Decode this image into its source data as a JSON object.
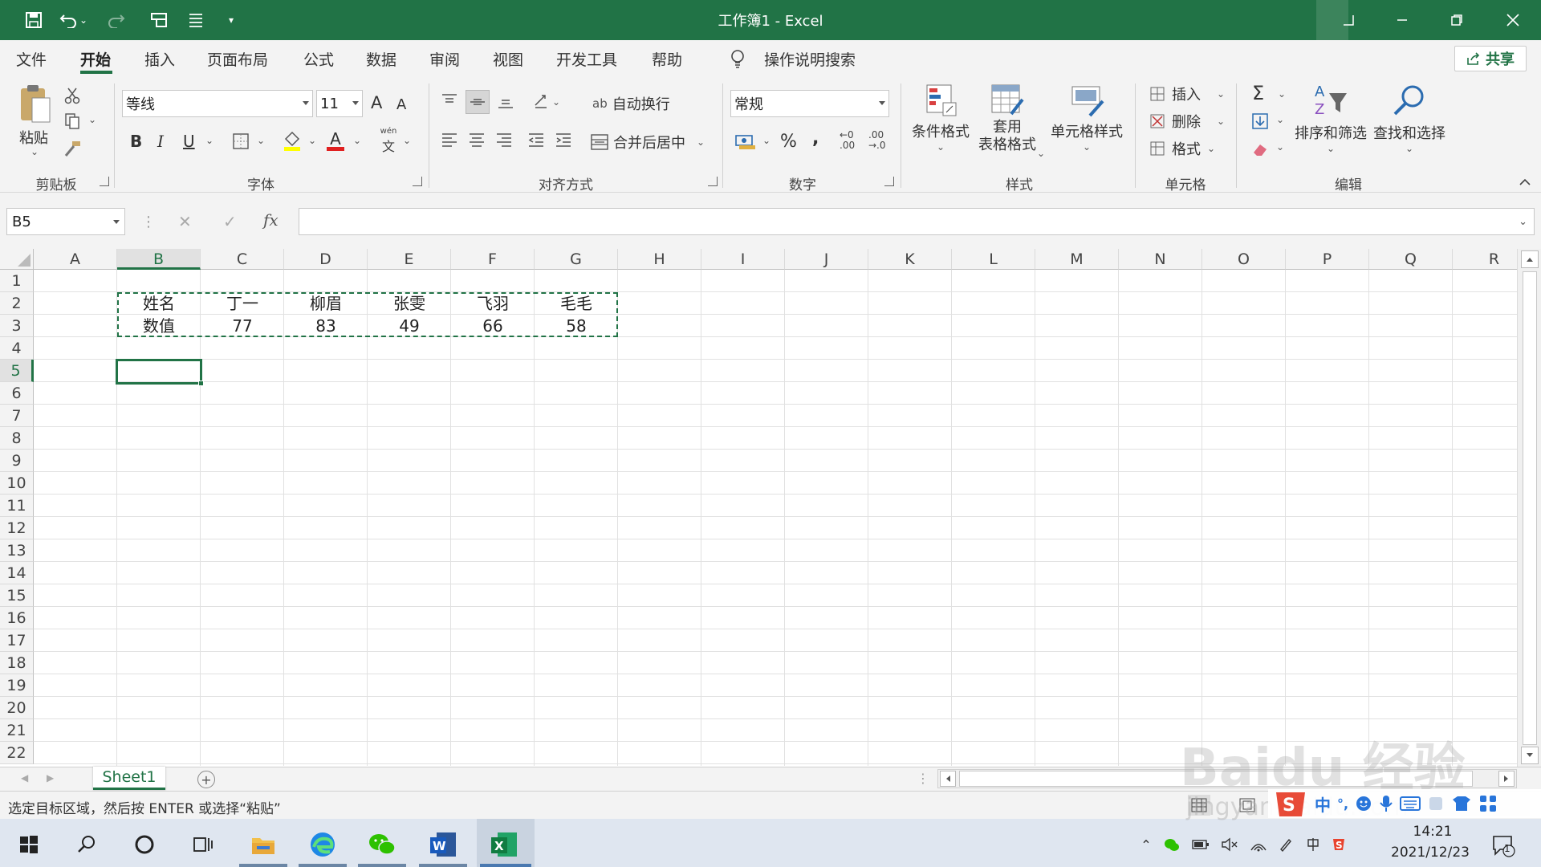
{
  "window": {
    "title": "工作簿1  -  Excel"
  },
  "menu_tabs": [
    "文件",
    "开始",
    "插入",
    "页面布局",
    "公式",
    "数据",
    "审阅",
    "视图",
    "开发工具",
    "帮助"
  ],
  "active_tab": "开始",
  "tell_me": "操作说明搜索",
  "share_label": "共享",
  "ribbon": {
    "clipboard": {
      "paste_label": "粘贴",
      "group_label": "剪贴板"
    },
    "font": {
      "font_name": "等线",
      "font_size": "11",
      "grow_label": "A",
      "shrink_label": "A",
      "bold": "B",
      "italic": "I",
      "underline": "U",
      "font_color_label": "A",
      "phonetic_top": "wén",
      "phonetic_bottom": "文",
      "group_label": "字体"
    },
    "alignment": {
      "wrap_label": "自动换行",
      "merge_label": "合并后居中",
      "wrap_glyph": "ab",
      "group_label": "对齐方式"
    },
    "number": {
      "format": "常规",
      "percent": "%",
      "comma": ",",
      "inc_top": "←0",
      "inc_bottom": ".00",
      "dec_top": ".00",
      "dec_bottom": "→.0",
      "group_label": "数字"
    },
    "styles": {
      "conditional_label": "条件格式",
      "table_label_1": "套用",
      "table_label_2": "表格格式",
      "cell_style_label": "单元格样式",
      "group_label": "样式"
    },
    "cells": {
      "insert_label": "插入",
      "delete_label": "删除",
      "format_label": "格式",
      "group_label": "单元格"
    },
    "editing": {
      "sigma": "Σ",
      "sort_label": "排序和筛选",
      "find_label": "查找和选择",
      "group_label": "编辑"
    }
  },
  "formula_bar": {
    "name_box": "B5",
    "fx": "fx",
    "cancel": "✕",
    "enter": "✓",
    "content": ""
  },
  "columns": [
    "A",
    "B",
    "C",
    "D",
    "E",
    "F",
    "G",
    "H",
    "I",
    "J",
    "K",
    "L",
    "M",
    "N",
    "O",
    "P",
    "Q",
    "R"
  ],
  "selected_column": "B",
  "rows": [
    "1",
    "2",
    "3",
    "4",
    "5",
    "6",
    "7",
    "8",
    "9",
    "10",
    "11",
    "12",
    "13",
    "14",
    "15",
    "16",
    "17",
    "18",
    "19",
    "20",
    "21",
    "22"
  ],
  "selected_row": "5",
  "cells": {
    "B2": "姓名",
    "C2": "丁一",
    "D2": "柳眉",
    "E2": "张雯",
    "F2": "飞羽",
    "G2": "毛毛",
    "B3": "数值",
    "C3": "77",
    "D3": "83",
    "E3": "49",
    "F3": "66",
    "G3": "58"
  },
  "sheet_tab": "Sheet1",
  "status_text": "选定目标区域，然后按 ENTER 或选择“粘贴”",
  "taskbar": {
    "time": "14:21",
    "date": "2021/12/23",
    "notification_count": "1"
  },
  "ime": {
    "lang": "中",
    "punct": "°,"
  },
  "watermark": {
    "line1": "Baidu 经验",
    "line2": "jingyan.baidu.com"
  },
  "colors": {
    "excel_green": "#217346",
    "title_bar": "#217346"
  }
}
